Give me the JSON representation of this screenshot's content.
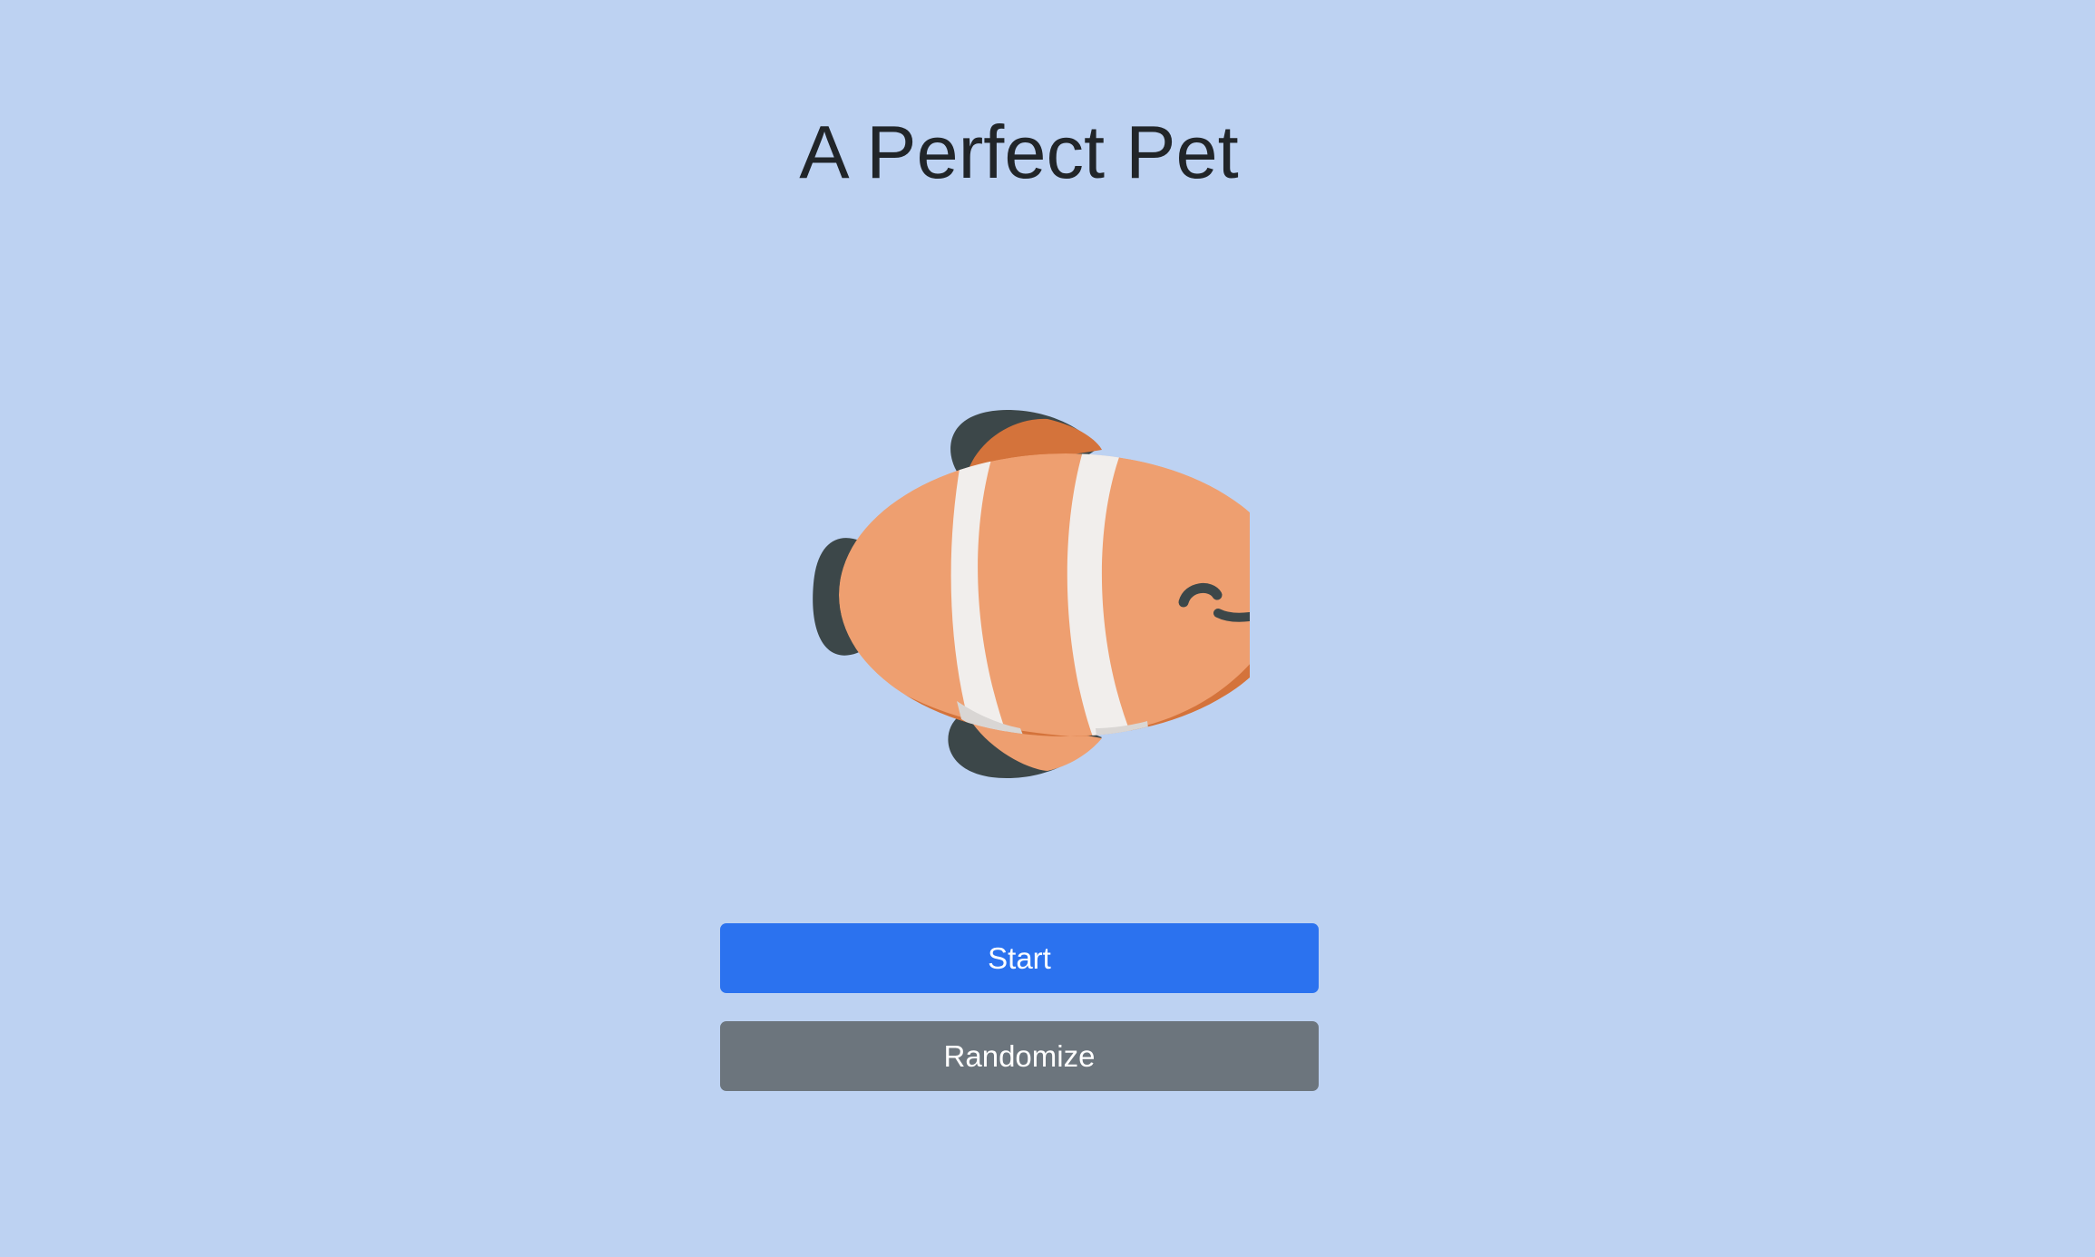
{
  "header": {
    "title": "A Perfect Pet"
  },
  "pet": {
    "icon": "clownfish-icon",
    "colors": {
      "body": "#ee9f70",
      "dark_orange": "#d4733b",
      "stripe": "#f1eeec",
      "stripe_shadow": "#d9d6d4",
      "fin_dark": "#3c4749"
    }
  },
  "actions": {
    "start_label": "Start",
    "randomize_label": "Randomize"
  },
  "colors": {
    "background": "#bdd2f2",
    "primary": "#2b72ef",
    "secondary": "#6c757d",
    "title_text": "#212529"
  }
}
